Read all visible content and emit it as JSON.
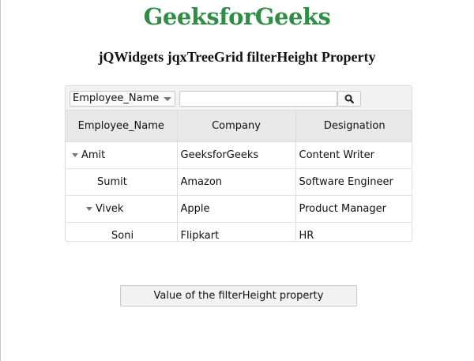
{
  "header": {
    "brand": "GeeksforGeeks",
    "subtitle": "jQWidgets jqxTreeGrid filterHeight Property"
  },
  "filter": {
    "selected_column": "Employee_Name",
    "input_value": "",
    "search_icon": "search-icon"
  },
  "grid": {
    "columns": [
      "Employee_Name",
      "Company",
      "Designation"
    ],
    "rows": [
      {
        "name": "Amit",
        "company": "GeeksforGeeks",
        "designation": "Content Writer",
        "level": 0,
        "expanded": true
      },
      {
        "name": "Sumit",
        "company": "Amazon",
        "designation": "Software Engineer",
        "level": 1,
        "expanded": null
      },
      {
        "name": "Vivek",
        "company": "Apple",
        "designation": "Product Manager",
        "level": 1,
        "expanded": true
      },
      {
        "name": "Soni",
        "company": "Flipkart",
        "designation": "HR",
        "level": 2,
        "expanded": null
      }
    ]
  },
  "action": {
    "button_label": "Value of the filterHeight property"
  },
  "colors": {
    "brand": "#2f8d46",
    "header_bg": "#e8e8e8",
    "border": "#dcdcdc"
  }
}
